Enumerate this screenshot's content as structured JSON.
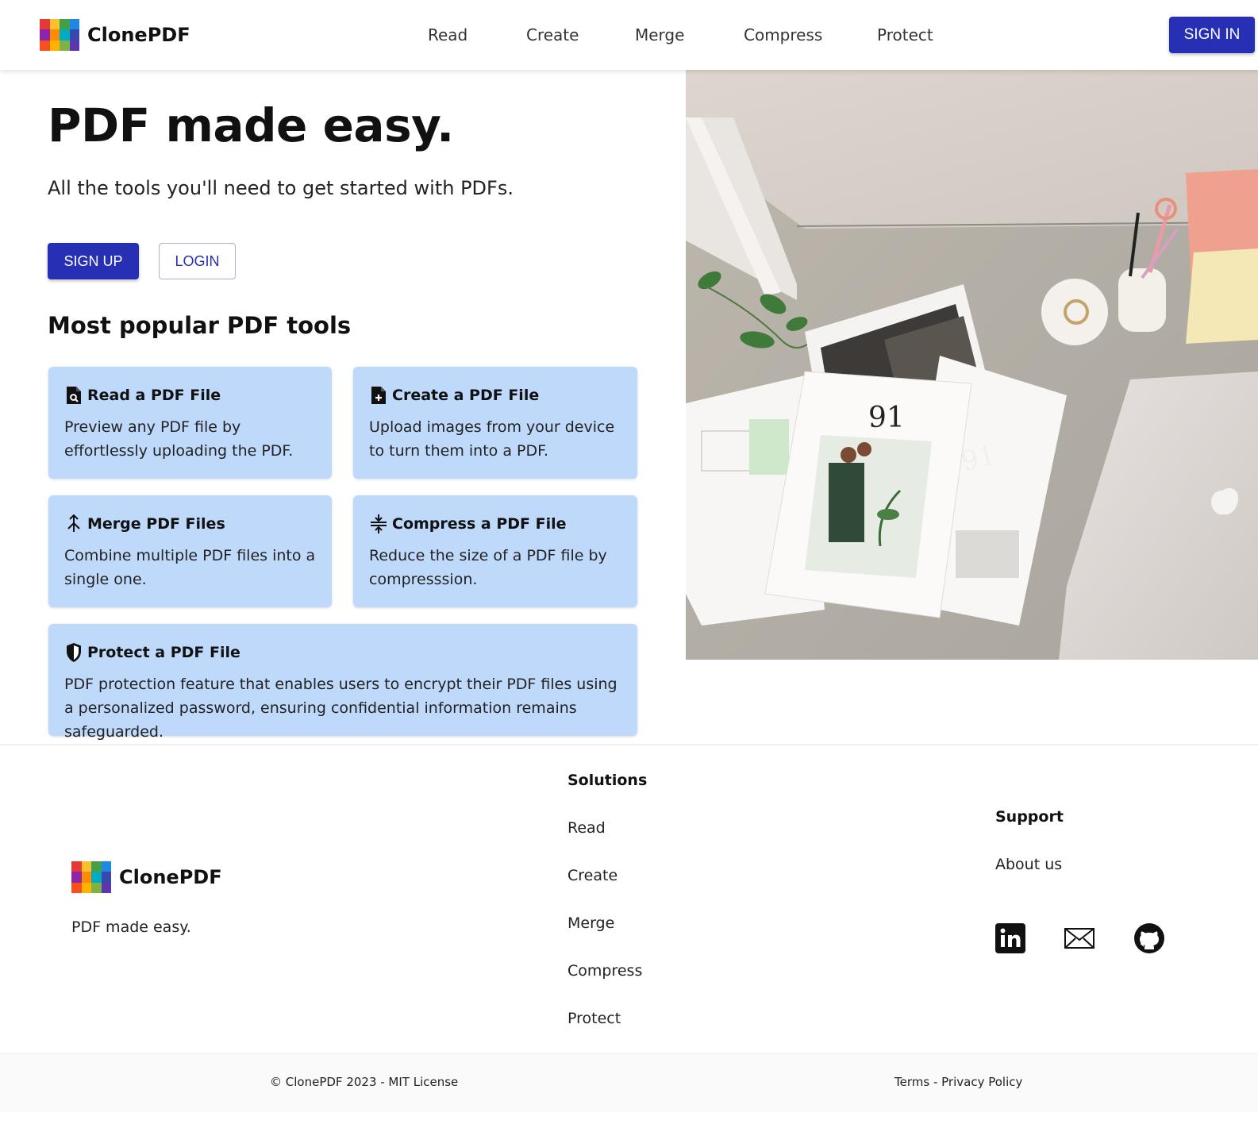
{
  "header": {
    "brand": "ClonePDF",
    "nav": [
      "Read",
      "Create",
      "Merge",
      "Compress",
      "Protect"
    ],
    "sign_in": "SIGN IN"
  },
  "hero": {
    "title": "PDF made easy.",
    "subtitle": "All the tools you'll need to get started with PDFs.",
    "sign_up": "SIGN UP",
    "login": "LOGIN",
    "section_title": "Most popular PDF tools"
  },
  "tools": [
    {
      "icon": "file-search-icon",
      "title": "Read a PDF File",
      "desc": "Preview any PDF file by effortlessly uploading the PDF."
    },
    {
      "icon": "file-plus-icon",
      "title": "Create a PDF File",
      "desc": "Upload images from your device to turn them into a PDF."
    },
    {
      "icon": "merge-icon",
      "title": "Merge PDF Files",
      "desc": "Combine multiple PDF files into a single one."
    },
    {
      "icon": "compress-icon",
      "title": "Compress a PDF File",
      "desc": "Reduce the size of a PDF file by compresssion."
    },
    {
      "icon": "shield-icon",
      "title": "Protect a PDF File",
      "desc": "PDF protection feature that enables users to encrypt their PDF files using a personalized password, ensuring confidential information remains safeguarded."
    }
  ],
  "photo": {
    "magazine_number": "91"
  },
  "footer": {
    "brand": "ClonePDF",
    "tagline": "PDF made easy.",
    "solutions_title": "Solutions",
    "solutions": [
      "Read",
      "Create",
      "Merge",
      "Compress",
      "Protect"
    ],
    "support_title": "Support",
    "support_links": [
      "About us"
    ],
    "social_icons": [
      "linkedin-icon",
      "mail-icon",
      "github-icon"
    ],
    "copyright": "© ClonePDF 2023 - MIT License",
    "terms": "Terms",
    "separator": " - ",
    "privacy": "Privacy Policy"
  },
  "colors": {
    "primary": "#2730b5",
    "card_bg": "#bfd9fb",
    "logo": [
      "#e53935",
      "#fbc02d",
      "#43a047",
      "#1e88e5",
      "#8e24aa",
      "#fb8c00",
      "#00acc1",
      "#3949ab",
      "#f4511e",
      "#ffb300",
      "#7cb342",
      "#5e35b1"
    ]
  }
}
